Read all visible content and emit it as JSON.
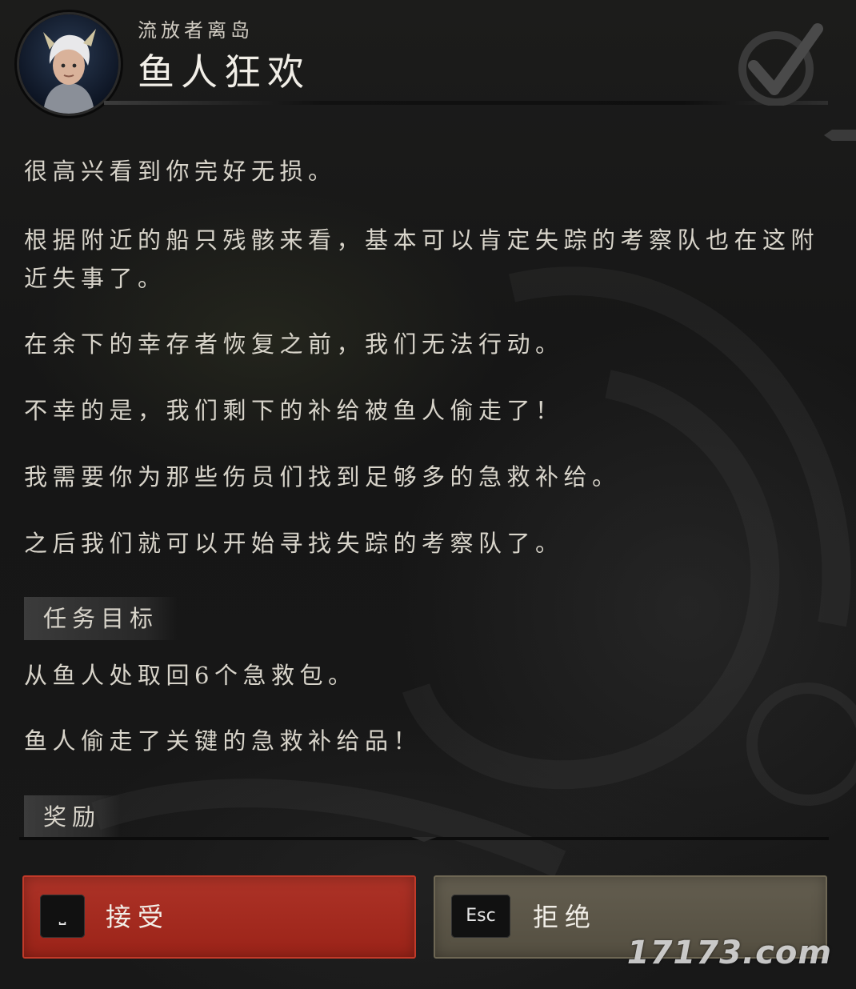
{
  "quest": {
    "zone": "流放者离岛",
    "title": "鱼人狂欢"
  },
  "description": [
    "很高兴看到你完好无损。",
    "根据附近的船只残骸来看，基本可以肯定失踪的考察队也在这附近失事了。",
    "在余下的幸存者恢复之前，我们无法行动。",
    "不幸的是，我们剩下的补给被鱼人偷走了！",
    "我需要你为那些伤员们找到足够多的急救补给。",
    "之后我们就可以开始寻找失踪的考察队了。"
  ],
  "objectives": {
    "label": "任务目标",
    "lines": [
      "从鱼人处取回6个急救包。",
      "鱼人偷走了关键的急救补给品！"
    ]
  },
  "rewards": {
    "label": "奖励"
  },
  "buttons": {
    "accept": {
      "key": "⎵",
      "label": "接受"
    },
    "decline": {
      "key": "Esc",
      "label": "拒绝"
    }
  },
  "watermark": "17173.com",
  "colors": {
    "accept": "#a8261a",
    "decline": "#5b5546",
    "background": "#161616"
  },
  "icons": {
    "portrait": "npc-portrait-icon",
    "complete": "check-mark-icon"
  }
}
